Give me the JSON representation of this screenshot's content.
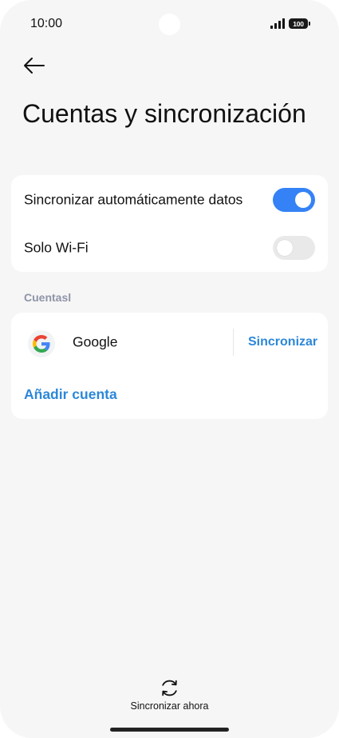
{
  "status_bar": {
    "time": "10:00",
    "battery": "100",
    "icons": [
      "signal-icon",
      "battery-icon"
    ]
  },
  "header": {
    "back_icon": "arrow-left-icon",
    "title": "Cuentas y sincronización"
  },
  "sync_settings": {
    "items": [
      {
        "label": "Sincronizar automáticamente datos",
        "enabled": true
      },
      {
        "label": "Solo Wi-Fi",
        "enabled": false
      }
    ]
  },
  "accounts": {
    "section_label": "Cuentasl",
    "items": [
      {
        "name": "Google",
        "icon": "google-icon",
        "action": "Sincronizar"
      }
    ],
    "add_label": "Añadir cuenta"
  },
  "footer": {
    "sync_now_icon": "sync-icon",
    "sync_now_label": "Sincronizar ahora"
  },
  "colors": {
    "accent": "#3482f6",
    "link": "#2c87d8",
    "background": "#f6f6f6",
    "card": "#ffffff",
    "section_label": "#8f94a8"
  }
}
